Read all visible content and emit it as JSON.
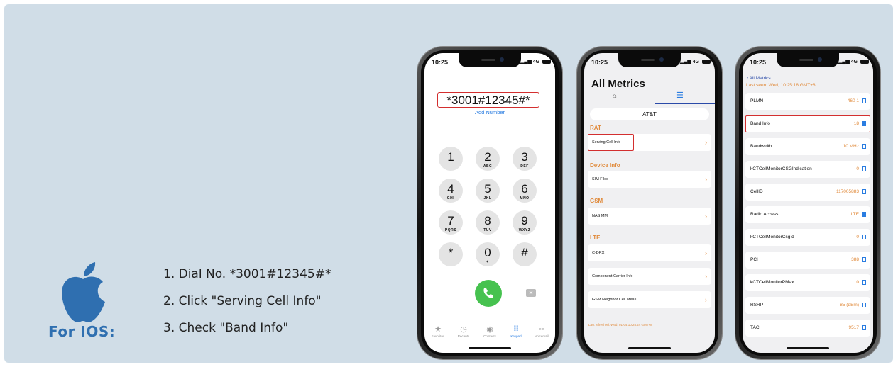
{
  "steps": [
    "1. Dial No. *3001#12345#*",
    "2. Click \"Serving Cell Info\"",
    "3. Check \"Band Info\""
  ],
  "platform_label": "For IOS:",
  "colors": {
    "accent_blue": "#2f6fb0",
    "highlight_red": "#d32f2f",
    "orange": "#e08a3b",
    "call_green": "#46c24f"
  },
  "phone1": {
    "time": "10:25",
    "signal": "4G",
    "dial_code": "*3001#12345#*",
    "add_number": "Add Number",
    "keys": [
      {
        "d": "1",
        "l": ""
      },
      {
        "d": "2",
        "l": "ABC"
      },
      {
        "d": "3",
        "l": "DEF"
      },
      {
        "d": "4",
        "l": "GHI"
      },
      {
        "d": "5",
        "l": "JKL"
      },
      {
        "d": "6",
        "l": "MNO"
      },
      {
        "d": "7",
        "l": "PQRS"
      },
      {
        "d": "8",
        "l": "TUV"
      },
      {
        "d": "9",
        "l": "WXYZ"
      },
      {
        "d": "*",
        "l": ""
      },
      {
        "d": "0",
        "l": "+"
      },
      {
        "d": "#",
        "l": ""
      }
    ],
    "tabs": [
      "Favorites",
      "Recents",
      "Contacts",
      "Keypad",
      "Voicemail"
    ]
  },
  "phone2": {
    "time": "10:25",
    "title": "All Metrics",
    "carrier": "AT&T",
    "sections": {
      "rat": "RAT",
      "device": "Device Info",
      "gsm": "GSM",
      "lte": "LTE"
    },
    "rows": {
      "serving": "Serving Cell Info",
      "sim": "SIM Files",
      "nas": "NAS MM",
      "cdrx": "C-DRX",
      "cc": "Component Carrier Info",
      "gsmnb": "GSM Neighbor Cell Meas"
    },
    "last_refreshed": "Last refreshed: Wed, 01-04 10:25:24 GMT+8"
  },
  "phone3": {
    "time": "10:25",
    "back": "All Metrics",
    "last_seen": "Last seen: Wed, 10:25:18 GMT+8",
    "rows": [
      {
        "label": "PLMN",
        "value": "460 1"
      },
      {
        "label": "Band Info",
        "value": "18"
      },
      {
        "label": "Bandwidth",
        "value": "10 MHz"
      },
      {
        "label": "kCTCellMonitorCSGIndication",
        "value": "0"
      },
      {
        "label": "CellID",
        "value": "117005883"
      },
      {
        "label": "Radio Access",
        "value": "LTE"
      },
      {
        "label": "kCTCellMonitorCsgId",
        "value": "0"
      },
      {
        "label": "PCI",
        "value": "388"
      },
      {
        "label": "kCTCellMonitorPMax",
        "value": "0"
      },
      {
        "label": "RSRP",
        "value": "-85 (dBm)"
      },
      {
        "label": "TAC",
        "value": "9517"
      }
    ]
  }
}
